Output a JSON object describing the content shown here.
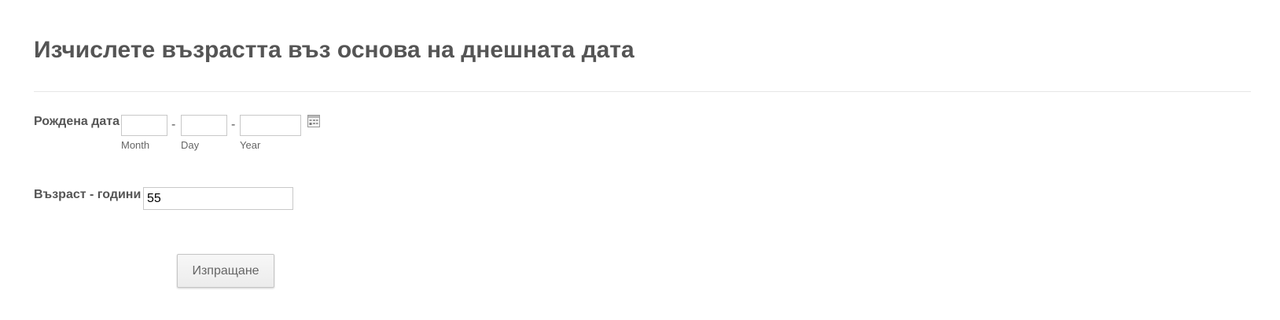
{
  "form": {
    "title": "Изчислете възрастта въз основа на днешната дата"
  },
  "birth_date": {
    "label": "Рождена дата",
    "separator": "-",
    "month": {
      "value": "",
      "sublabel": "Month"
    },
    "day": {
      "value": "",
      "sublabel": "Day"
    },
    "year": {
      "value": "",
      "sublabel": "Year"
    },
    "calendar_icon": "calendar-icon"
  },
  "age": {
    "label": "Възраст - години",
    "value": "55"
  },
  "submit": {
    "label": "Изпращане"
  },
  "colors": {
    "text": "#555555",
    "border": "#c8c8c8",
    "divider": "#e6e6e6",
    "button_bg": "#f2f2f2"
  }
}
